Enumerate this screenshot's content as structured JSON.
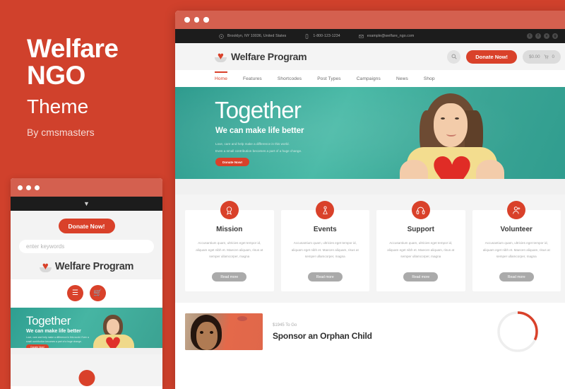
{
  "promo": {
    "title_line1": "Welfare",
    "title_line2": "NGO",
    "subtitle": "Theme",
    "author": "By cmsmasters",
    "accent_color": "#d0412c"
  },
  "mobile": {
    "donate_label": "Donate Now!",
    "search_placeholder": "enter keywords",
    "logo_text": "Welfare Program",
    "menu_icon": "hamburger-icon",
    "cart_icon": "cart-icon",
    "chevron_icon": "chevron-down-icon",
    "hero": {
      "title": "Together",
      "subtitle": "We can make life better",
      "paragraph": "Love, care and help make a difference in this world. Even a small contribution becomes a part of a huge change.",
      "button": "Donate Now!"
    }
  },
  "browser": {
    "infobar": {
      "address": "Brooklyn, NY 10036, United States",
      "phone": "1-800-123-1234",
      "email": "example@welfare_ngo.com",
      "socials": [
        "twitter-icon",
        "facebook-icon",
        "vimeo-icon",
        "googleplus-icon"
      ]
    },
    "header": {
      "logo_text": "Welfare Program",
      "search_icon": "search-icon",
      "donate_label": "Donate Now!",
      "cart_amount": "$0.00",
      "cart_icon": "cart-icon",
      "cart_count": "0"
    },
    "nav": [
      {
        "label": "Home",
        "active": true
      },
      {
        "label": "Features",
        "active": false
      },
      {
        "label": "Shortcodes",
        "active": false
      },
      {
        "label": "Post Types",
        "active": false
      },
      {
        "label": "Campaigns",
        "active": false
      },
      {
        "label": "News",
        "active": false
      },
      {
        "label": "Shop",
        "active": false
      }
    ],
    "hero": {
      "title": "Together",
      "subtitle": "We can make life better",
      "paragraph_line1": "Love, care and help make a difference in this world.",
      "paragraph_line2": "Even a small contribution becomes a part of a huge change.",
      "button": "Donate Now!"
    },
    "services": [
      {
        "title": "Mission",
        "icon": "ribbon-award-icon",
        "text": "Accusantium quam, ultricies eget tempor id, aliquam eget nibh et. Maecen aliquam, risus at semper ullamcorper, magna",
        "button": "Read more"
      },
      {
        "title": "Events",
        "icon": "speaker-podium-icon",
        "text": "Accusantium quam, ultricies eget tempor id, aliquam eget nibh et. Maecen aliquam, risus at semper ullamcorper, magna",
        "button": "Read more"
      },
      {
        "title": "Support",
        "icon": "headphones-icon",
        "text": "Accusantium quam, ultricies eget tempor id, aliquam eget nibh et. Maecen aliquam, risus at semper ullamcorper, magna",
        "button": "Read more"
      },
      {
        "title": "Volunteer",
        "icon": "add-person-icon",
        "text": "Accusantium quam, ultricies eget tempor id, aliquam eget nibh et. Maecen aliquam, risus at semper ullamcorper, magna",
        "button": "Read more"
      }
    ],
    "campaign": {
      "goal": "$1945 To Go",
      "title": "Sponsor an Orphan Child",
      "progress_percent": 32,
      "progress_color": "#d9412a",
      "track_color": "#eeeeee"
    }
  }
}
